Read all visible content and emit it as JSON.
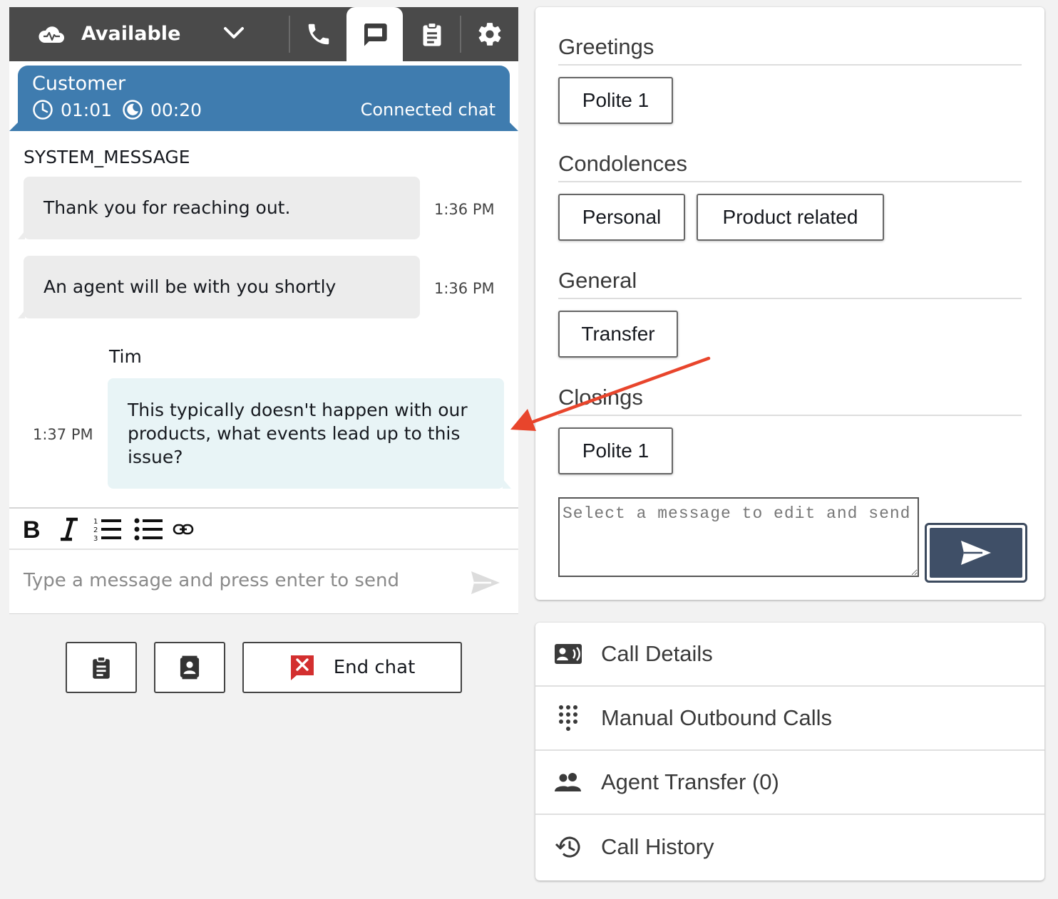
{
  "topbar": {
    "status": "Available",
    "icons": [
      "cloud-status-icon",
      "chevron-down-icon",
      "phone-icon",
      "chat-icon",
      "clipboard-icon",
      "gear-icon"
    ]
  },
  "contact": {
    "name": "Customer",
    "timer_total": "01:01",
    "timer_state": "00:20",
    "state": "Connected chat"
  },
  "transcript": {
    "system_label": "SYSTEM_MESSAGE",
    "messages_in": [
      {
        "text": "Thank you for reaching out.",
        "time": "1:36 PM"
      },
      {
        "text": "An agent will be with you shortly",
        "time": "1:36 PM"
      }
    ],
    "agent_name": "Tim",
    "message_out": {
      "text": "This typically doesn't happen with our products, what events lead up to this issue?",
      "time": "1:37 PM"
    }
  },
  "composer": {
    "placeholder": "Type a message and press enter to send",
    "format_icons": [
      "bold-icon",
      "italic-icon",
      "numbered-list-icon",
      "bulleted-list-icon",
      "link-icon"
    ]
  },
  "actions": {
    "end_chat_label": "End chat",
    "icons": [
      "clipboard-icon",
      "contact-card-icon",
      "end-chat-icon"
    ]
  },
  "quick_responses": {
    "sections": [
      {
        "heading": "Greetings",
        "buttons": [
          "Polite 1"
        ]
      },
      {
        "heading": "Condolences",
        "buttons": [
          "Personal",
          "Product related"
        ]
      },
      {
        "heading": "General",
        "buttons": [
          "Transfer"
        ]
      },
      {
        "heading": "Closings",
        "buttons": [
          "Polite 1"
        ]
      }
    ],
    "textarea_placeholder": "Select a message to edit and send"
  },
  "tools": {
    "items": [
      {
        "label": "Call Details",
        "icon": "contact-card-icon"
      },
      {
        "label": "Manual Outbound Calls",
        "icon": "dialpad-icon"
      },
      {
        "label": "Agent Transfer (0)",
        "icon": "people-icon"
      },
      {
        "label": "Call History",
        "icon": "history-icon"
      }
    ]
  },
  "colors": {
    "topbar": "#4a4a4a",
    "contact_header": "#3f7caf",
    "bubble_in": "#ececec",
    "bubble_out": "#e8f4f6",
    "send_button": "#3f4f67",
    "end_chat_red": "#d32f2f",
    "annotation_arrow": "#e8452c"
  }
}
